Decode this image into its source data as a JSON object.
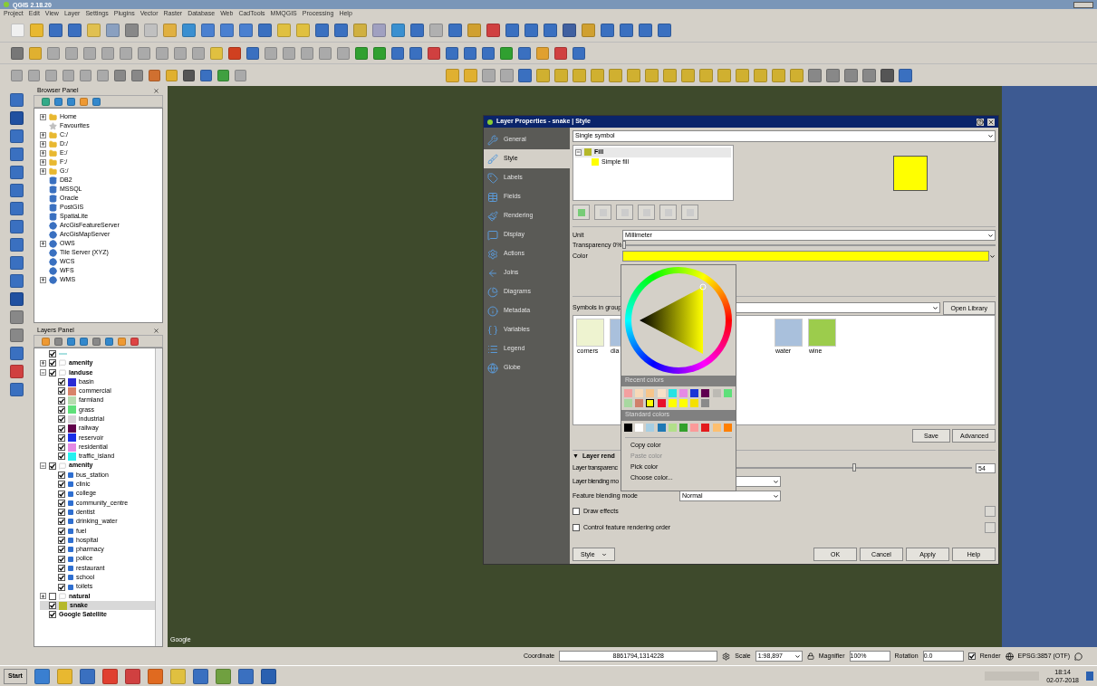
{
  "window": {
    "title": "QGIS 2.18.20"
  },
  "menu": [
    "Project",
    "Edit",
    "View",
    "Layer",
    "Settings",
    "Plugins",
    "Vector",
    "Raster",
    "Database",
    "Web",
    "CadTools",
    "MMQGIS",
    "Processing",
    "Help"
  ],
  "browser_panel": {
    "title": "Browser Panel",
    "items": [
      {
        "label": "Home",
        "kind": "folder",
        "expandable": true
      },
      {
        "label": "Favourites",
        "kind": "favourites",
        "expandable": false
      },
      {
        "label": "C:/",
        "kind": "folder",
        "expandable": true
      },
      {
        "label": "D:/",
        "kind": "folder",
        "expandable": true
      },
      {
        "label": "E:/",
        "kind": "folder",
        "expandable": true
      },
      {
        "label": "F:/",
        "kind": "folder",
        "expandable": true
      },
      {
        "label": "G:/",
        "kind": "folder",
        "expandable": true
      },
      {
        "label": "DB2",
        "kind": "database",
        "expandable": false
      },
      {
        "label": "MSSQL",
        "kind": "database",
        "expandable": false
      },
      {
        "label": "Oracle",
        "kind": "database",
        "expandable": false
      },
      {
        "label": "PostGIS",
        "kind": "database",
        "expandable": false
      },
      {
        "label": "SpatiaLite",
        "kind": "database",
        "expandable": false
      },
      {
        "label": "ArcGisFeatureServer",
        "kind": "service",
        "expandable": false
      },
      {
        "label": "ArcGisMapServer",
        "kind": "service",
        "expandable": false
      },
      {
        "label": "OWS",
        "kind": "service",
        "expandable": true
      },
      {
        "label": "Tile Server (XYZ)",
        "kind": "service",
        "expandable": false
      },
      {
        "label": "WCS",
        "kind": "service",
        "expandable": false
      },
      {
        "label": "WFS",
        "kind": "service",
        "expandable": false
      },
      {
        "label": "WMS",
        "kind": "service",
        "expandable": true
      }
    ]
  },
  "layers_panel": {
    "title": "Layers Panel",
    "items": [
      {
        "kind": "line",
        "color": "#a8e0e0",
        "checked": true,
        "selected": false
      },
      {
        "label": "amenity",
        "kind": "group",
        "checked": true,
        "expanded": false,
        "selected": false
      },
      {
        "label": "landuse",
        "kind": "group",
        "checked": true,
        "expanded": true,
        "selected": false,
        "children": [
          {
            "label": "basin",
            "kind": "fill",
            "color": "#2b2bd4",
            "checked": true,
            "selected": false
          },
          {
            "label": "commercial",
            "kind": "fill",
            "color": "#d8836a",
            "checked": true,
            "selected": false
          },
          {
            "label": "farmland",
            "kind": "fill",
            "color": "#b7dcb0",
            "checked": true,
            "selected": false
          },
          {
            "label": "grass",
            "kind": "fill",
            "color": "#5fe07a",
            "checked": true,
            "selected": false
          },
          {
            "label": "industrial",
            "kind": "fill",
            "color": "#d8d4d8",
            "checked": true,
            "selected": false
          },
          {
            "label": "railway",
            "kind": "fill",
            "color": "#60004a",
            "checked": true,
            "selected": false
          },
          {
            "label": "reservoir",
            "kind": "fill",
            "color": "#1a2ee8",
            "checked": true,
            "selected": false
          },
          {
            "label": "residential",
            "kind": "fill",
            "color": "#e48ae4",
            "checked": true,
            "selected": false
          },
          {
            "label": "traffic_island",
            "kind": "fill",
            "color": "#28f0f0",
            "checked": true,
            "selected": false
          }
        ]
      },
      {
        "label": "amenity",
        "kind": "group",
        "checked": true,
        "expanded": true,
        "selected": false,
        "children": [
          {
            "label": "bus_station",
            "kind": "point",
            "checked": true,
            "selected": false
          },
          {
            "label": "clinic",
            "kind": "point",
            "checked": true,
            "selected": false
          },
          {
            "label": "college",
            "kind": "point",
            "checked": true,
            "selected": false
          },
          {
            "label": "community_centre",
            "kind": "point",
            "checked": true,
            "selected": false
          },
          {
            "label": "dentist",
            "kind": "point",
            "checked": true,
            "selected": false
          },
          {
            "label": "drinking_water",
            "kind": "point",
            "checked": true,
            "selected": false
          },
          {
            "label": "fuel",
            "kind": "point",
            "checked": true,
            "selected": false
          },
          {
            "label": "hospital",
            "kind": "point",
            "checked": true,
            "selected": false
          },
          {
            "label": "pharmacy",
            "kind": "point",
            "checked": true,
            "selected": false
          },
          {
            "label": "police",
            "kind": "point",
            "checked": true,
            "selected": false
          },
          {
            "label": "restaurant",
            "kind": "point",
            "checked": true,
            "selected": false
          },
          {
            "label": "school",
            "kind": "point",
            "checked": true,
            "selected": false
          },
          {
            "label": "toilets",
            "kind": "point",
            "checked": true,
            "selected": false
          }
        ]
      },
      {
        "label": "natural",
        "kind": "group",
        "checked": false,
        "expanded": false,
        "selected": false
      },
      {
        "label": "snake",
        "kind": "fill",
        "color": "#b5b82a",
        "checked": true,
        "selected": true
      },
      {
        "label": "Google Satellite",
        "kind": "raster",
        "checked": true,
        "selected": false
      }
    ]
  },
  "map": {
    "logo": "Google"
  },
  "dialog": {
    "title": "Layer Properties - snake | Style",
    "nav": [
      {
        "label": "General",
        "selected": false
      },
      {
        "label": "Style",
        "selected": true
      },
      {
        "label": "Labels",
        "selected": false
      },
      {
        "label": "Fields",
        "selected": false
      },
      {
        "label": "Rendering",
        "selected": false
      },
      {
        "label": "Display",
        "selected": false
      },
      {
        "label": "Actions",
        "selected": false
      },
      {
        "label": "Joins",
        "selected": false
      },
      {
        "label": "Diagrams",
        "selected": false
      },
      {
        "label": "Metadata",
        "selected": false
      },
      {
        "label": "Variables",
        "selected": false
      },
      {
        "label": "Legend",
        "selected": false
      },
      {
        "label": "Globe",
        "selected": false
      }
    ],
    "renderer": "Single symbol",
    "symbol_tree": {
      "label": "Fill",
      "color": "#b5b82a",
      "children": [
        {
          "label": "Simple fill",
          "color": "#ffff00"
        }
      ]
    },
    "preview": {
      "color": "#ffff00"
    },
    "unit": {
      "label": "Unit",
      "value": "Millimeter"
    },
    "transparency": {
      "label": "Transparency 0%",
      "level": 0
    },
    "color_field": {
      "label": "Color",
      "color": "#ffff00"
    },
    "symbols_label": "Symbols in group",
    "open_library": "Open Library",
    "symbols": [
      {
        "label": "corners",
        "color": "#eef3d0"
      },
      {
        "label": "dia",
        "color": "#a9c0dc"
      },
      {
        "label": "water",
        "color": "#a9c0dc"
      },
      {
        "label": "wine",
        "color": "#9ccc4c"
      }
    ],
    "save": "Save",
    "advanced": "Advanced",
    "layer_rendering": {
      "toggle": "▼",
      "title": "Layer rend",
      "transparency_label": "Layer transparenc",
      "level": 0.54,
      "value": "54",
      "blending_label": "Layer blending mo",
      "feature_blending_label": "Feature blending mode",
      "feature_blending": "Normal"
    },
    "checkboxes": [
      {
        "label": "Draw effects",
        "checked": false
      },
      {
        "label": "Control feature rendering order",
        "checked": false
      }
    ],
    "buttons": {
      "style": "Style",
      "ok": "OK",
      "cancel": "Cancel",
      "apply": "Apply",
      "help": "Help"
    }
  },
  "color_popup": {
    "recent_title": "Recent colors",
    "recent": [
      {
        "color": "#f4a0a0",
        "selected": false
      },
      {
        "color": "#f7d9b8",
        "selected": false
      },
      {
        "color": "#f7c58a",
        "selected": false
      },
      {
        "color": "#f7e1c8",
        "selected": false
      },
      {
        "color": "#27e3e3",
        "selected": false
      },
      {
        "color": "#e58ae5",
        "selected": false
      },
      {
        "color": "#1a34d6",
        "selected": false
      },
      {
        "color": "#600050",
        "selected": false
      },
      {
        "color": "#bcbab4",
        "selected": false
      },
      {
        "color": "#5ee07a",
        "selected": false
      },
      {
        "color": "#a8d8a0",
        "selected": false
      },
      {
        "color": "#d0806a",
        "selected": false
      },
      {
        "color": "#ffff00",
        "selected": true
      },
      {
        "color": "#e8102a",
        "selected": false
      },
      {
        "color": "#ffff00",
        "selected": false
      },
      {
        "color": "#ffff00",
        "selected": false
      },
      {
        "color": "#f4e000",
        "selected": false
      },
      {
        "color": "#8a8a8a",
        "selected": false
      }
    ],
    "standard_title": "Standard colors",
    "standard": [
      {
        "color": "#000000"
      },
      {
        "color": "#ffffff"
      },
      {
        "color": "#a6cee3"
      },
      {
        "color": "#1f78b4"
      },
      {
        "color": "#b2df8a"
      },
      {
        "color": "#33a02c"
      },
      {
        "color": "#fb9a99"
      },
      {
        "color": "#e31a1c"
      },
      {
        "color": "#fdbf6f"
      },
      {
        "color": "#ff7f00"
      }
    ],
    "menu": [
      {
        "label": "Copy color",
        "disabled": false
      },
      {
        "label": "Paste color",
        "disabled": true
      },
      {
        "label": "Pick color",
        "disabled": false
      },
      {
        "label": "Choose color...",
        "disabled": false
      }
    ]
  },
  "status_bar": {
    "coordinate_label": "Coordinate",
    "coordinate": "8861794,1314228",
    "scale_label": "Scale",
    "scale": "1:98,897",
    "magnifier_label": "Magnifier",
    "magnifier": "100%",
    "rotation_label": "Rotation",
    "rotation": "0.0",
    "render_label": "Render",
    "render": true,
    "crs": "EPSG:3857 (OTF)"
  },
  "taskbar": {
    "start": "Start",
    "time": "18:14",
    "date": "02-07-2018"
  }
}
